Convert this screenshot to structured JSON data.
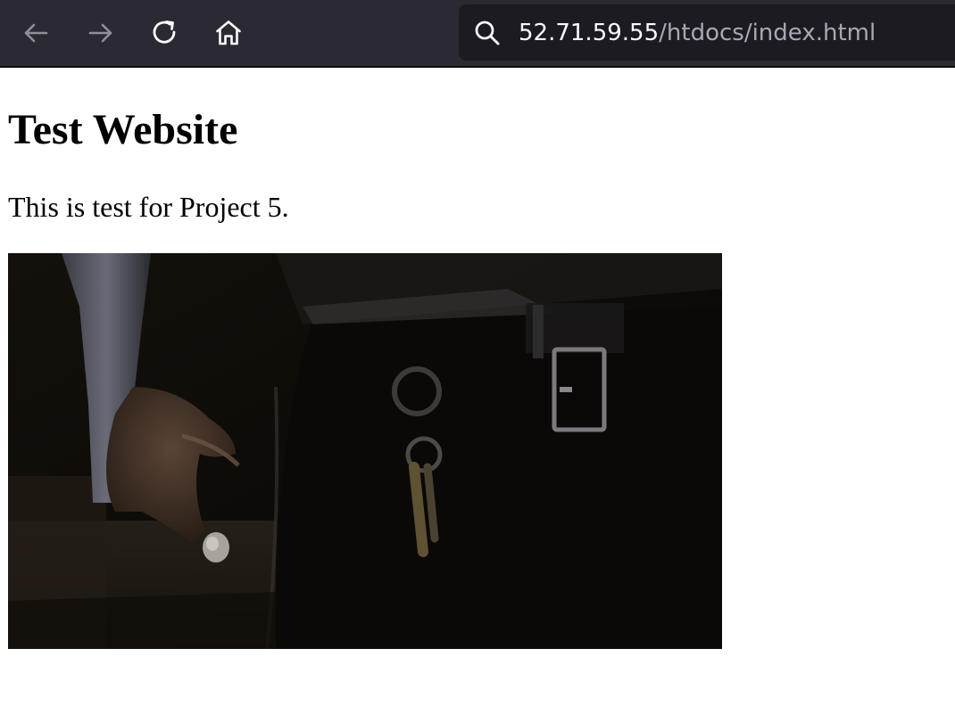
{
  "browser": {
    "toolbar": {
      "back_icon": "arrow-left-icon",
      "forward_icon": "arrow-right-icon",
      "reload_icon": "reload-icon",
      "home_icon": "home-icon"
    },
    "urlbar": {
      "search_icon": "search-icon",
      "host": "52.71.59.55",
      "path": "/htdocs/index.html"
    },
    "colors": {
      "toolbar_bg": "#2b2a33",
      "urlbar_bg": "#1c1b22",
      "url_host": "#fbfbfe",
      "url_path": "#a9a8b3"
    }
  },
  "page": {
    "heading": "Test Website",
    "paragraph": "This is test for Project 5."
  }
}
